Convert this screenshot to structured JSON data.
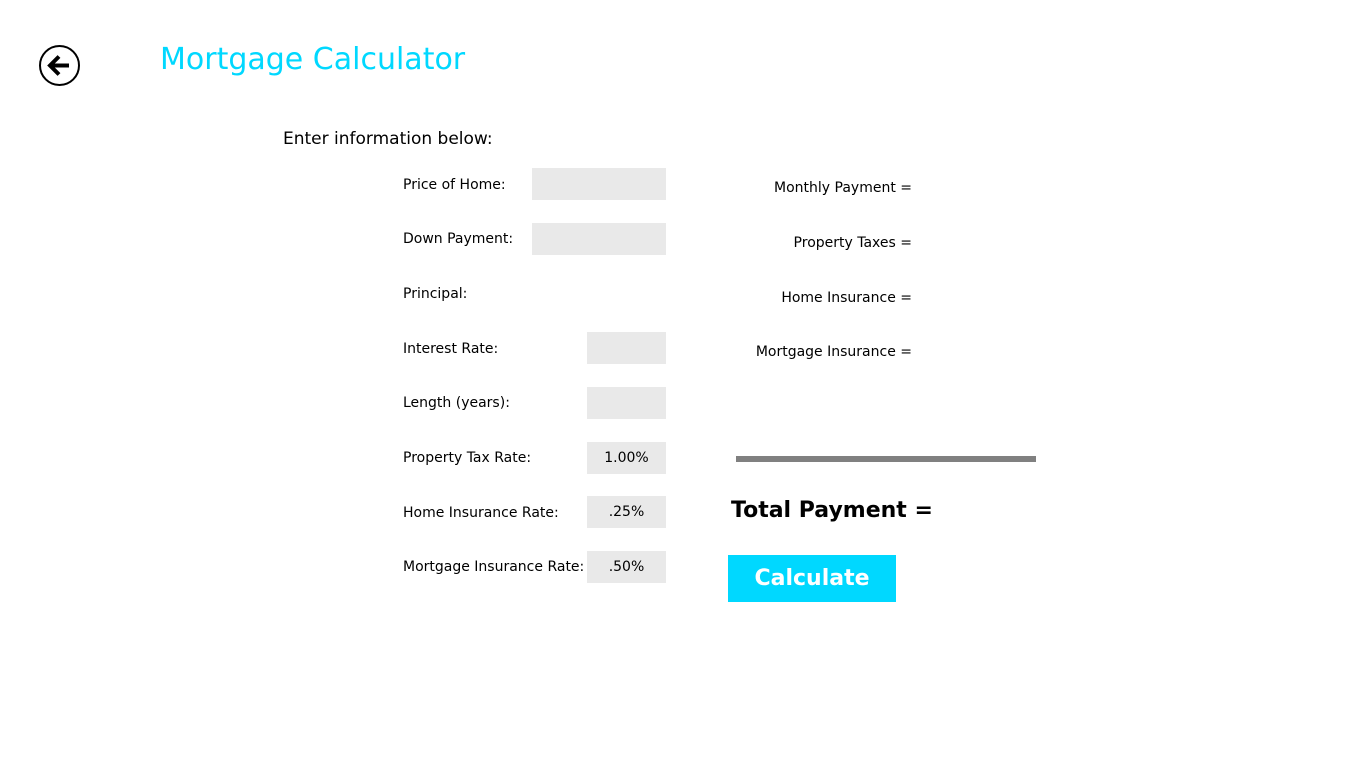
{
  "header": {
    "title": "Mortgage Calculator",
    "back_icon": "back-arrow-icon"
  },
  "form": {
    "instructions": "Enter information below:",
    "fields": {
      "price_of_home": {
        "label": "Price of Home:",
        "value": ""
      },
      "down_payment": {
        "label": "Down Payment:",
        "value": ""
      },
      "principal": {
        "label": "Principal:",
        "value": ""
      },
      "interest_rate": {
        "label": "Interest Rate:",
        "value": ""
      },
      "length_years": {
        "label": "Length (years):",
        "value": ""
      },
      "property_tax_rate": {
        "label": "Property Tax Rate:",
        "value": "1.00%"
      },
      "home_insurance_rate": {
        "label": "Home Insurance Rate:",
        "value": ".25%"
      },
      "mortgage_insurance_rate": {
        "label": "Mortgage Insurance Rate:",
        "value": ".50%"
      }
    }
  },
  "results": {
    "monthly_payment": "Monthly Payment =",
    "property_taxes": "Property Taxes =",
    "home_insurance": "Home Insurance =",
    "mortgage_insurance": "Mortgage Insurance =",
    "total_payment": "Total Payment ="
  },
  "actions": {
    "calculate_label": "Calculate"
  },
  "colors": {
    "accent": "#00d8ff",
    "field_background": "#e9e9e9",
    "divider": "#808080"
  }
}
